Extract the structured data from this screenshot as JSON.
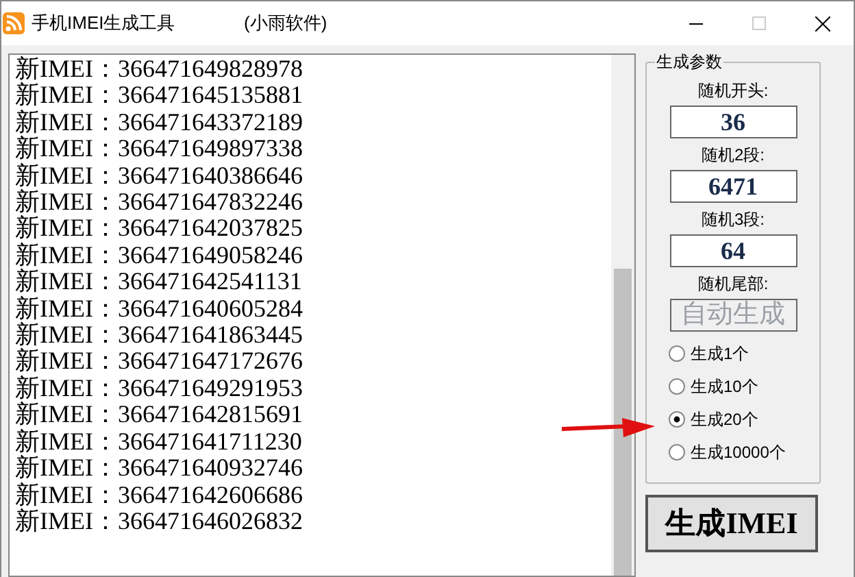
{
  "window": {
    "title": "手机IMEI生成工具",
    "subtitle": "(小雨软件)"
  },
  "output": {
    "lines": [
      "新IMEI：366471649828978",
      "新IMEI：366471645135881",
      "新IMEI：366471643372189",
      "新IMEI：366471649897338",
      "新IMEI：366471640386646",
      "新IMEI：366471647832246",
      "新IMEI：366471642037825",
      "新IMEI：366471649058246",
      "新IMEI：366471642541131",
      "新IMEI：366471640605284",
      "新IMEI：366471641863445",
      "新IMEI：366471647172676",
      "新IMEI：366471649291953",
      "新IMEI：366471642815691",
      "新IMEI：366471641711230",
      "新IMEI：366471640932746",
      "新IMEI：366471642606686",
      "新IMEI：366471646026832"
    ]
  },
  "params": {
    "title": "生成参数",
    "fields": [
      {
        "label": "随机开头:",
        "value": "36",
        "disabled": false
      },
      {
        "label": "随机2段:",
        "value": "6471",
        "disabled": false
      },
      {
        "label": "随机3段:",
        "value": "64",
        "disabled": false
      },
      {
        "label": "随机尾部:",
        "value": "自动生成",
        "disabled": true
      }
    ],
    "options": [
      {
        "label": "生成1个",
        "selected": false
      },
      {
        "label": "生成10个",
        "selected": false
      },
      {
        "label": "生成20个",
        "selected": true
      },
      {
        "label": "生成10000个",
        "selected": false
      }
    ]
  },
  "generate_button": "生成IMEI"
}
